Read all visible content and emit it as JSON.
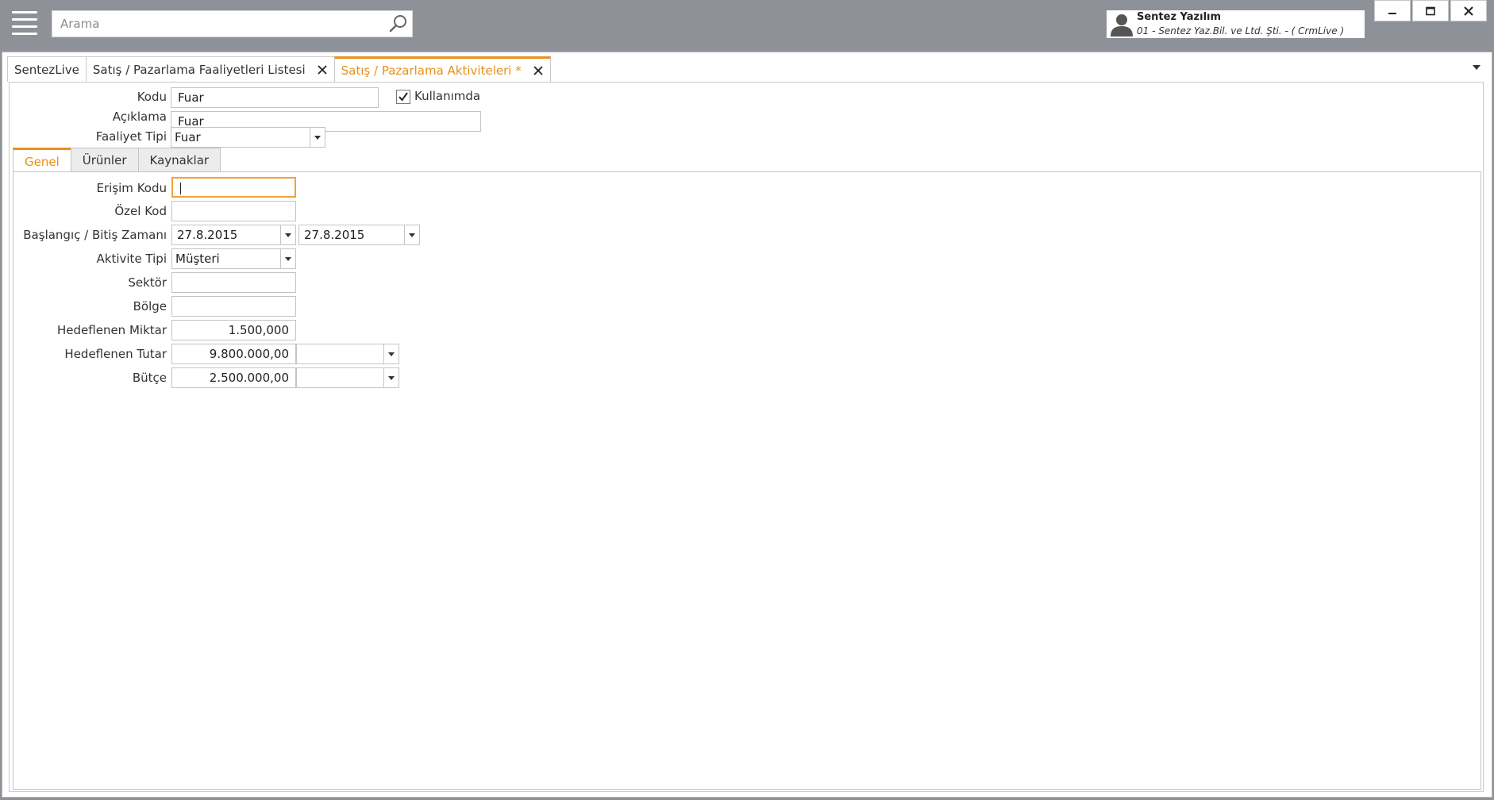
{
  "topbar": {
    "search_placeholder": "Arama",
    "user_name": "Sentez Yazılım",
    "user_company": "01 - Sentez Yaz.Bil. ve Ltd. Şti. - ( CrmLive )"
  },
  "doc_tabs": [
    {
      "label": "SentezLive"
    },
    {
      "label": "Satış / Pazarlama Faaliyetleri Listesi"
    },
    {
      "label": "Satış / Pazarlama Aktiviteleri *"
    }
  ],
  "header_form": {
    "kodu_label": "Kodu",
    "kodu_value": "Fuar",
    "kullanimda_label": "Kullanımda",
    "kullanimda_checked": true,
    "aciklama_label": "Açıklama",
    "aciklama_value": "Fuar",
    "faaliyet_tipi_label": "Faaliyet Tipi",
    "faaliyet_tipi_value": "Fuar"
  },
  "inner_tabs": [
    {
      "label": "Genel"
    },
    {
      "label": "Ürünler"
    },
    {
      "label": "Kaynaklar"
    }
  ],
  "genel": {
    "erisim_kodu_label": "Erişim Kodu",
    "erisim_kodu_value": "",
    "ozel_kod_label": "Özel Kod",
    "ozel_kod_value": "",
    "baslangic_bitis_label": "Başlangıç / Bitiş Zamanı",
    "baslangic_value": "27.8.2015",
    "bitis_value": "27.8.2015",
    "aktivite_tipi_label": "Aktivite Tipi",
    "aktivite_tipi_value": "Müşteri",
    "sektor_label": "Sektör",
    "sektor_value": "",
    "bolge_label": "Bölge",
    "bolge_value": "",
    "hedeflenen_miktar_label": "Hedeflenen Miktar",
    "hedeflenen_miktar_value": "1.500,000",
    "hedeflenen_tutar_label": "Hedeflenen Tutar",
    "hedeflenen_tutar_value": "9.800.000,00",
    "hedeflenen_tutar_currency": "",
    "butce_label": "Bütçe",
    "butce_value": "2.500.000,00",
    "butce_currency": ""
  },
  "colors": {
    "accent": "#e8901a",
    "topbar_bg": "#8e9197",
    "focus_border": "#f0a23c"
  },
  "icons": [
    "menu-icon",
    "search-icon",
    "user-avatar-icon",
    "minimize-icon",
    "maximize-icon",
    "close-icon",
    "chevron-down-icon",
    "check-icon"
  ]
}
